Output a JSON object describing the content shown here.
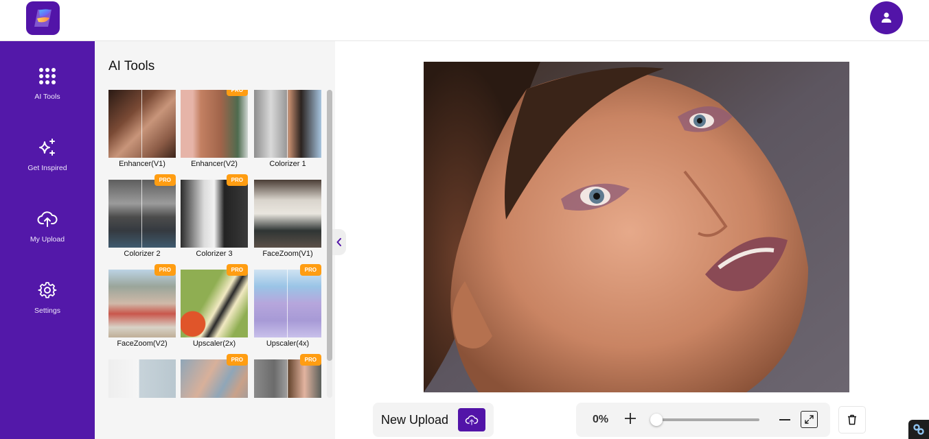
{
  "app": {
    "logo_icon": "app-logo",
    "brand_color": "#5214a8",
    "pro_badge_color": "#ff9d12"
  },
  "header": {
    "account_icon": "user-icon"
  },
  "sidebar": {
    "items": [
      {
        "label": "AI Tools",
        "icon": "grid-icon"
      },
      {
        "label": "Get Inspired",
        "icon": "sparkles-icon"
      },
      {
        "label": "My Upload",
        "icon": "cloud-upload-icon"
      },
      {
        "label": "Settings",
        "icon": "gear-icon"
      }
    ]
  },
  "tools_panel": {
    "title": "AI Tools",
    "pro_label": "PRO",
    "tools": [
      {
        "name": "Enhancer(V1)",
        "pro": false
      },
      {
        "name": "Enhancer(V2)",
        "pro": true
      },
      {
        "name": "Colorizer 1",
        "pro": false
      },
      {
        "name": "Colorizer 2",
        "pro": true
      },
      {
        "name": "Colorizer 3",
        "pro": true
      },
      {
        "name": "FaceZoom(V1)",
        "pro": false
      },
      {
        "name": "FaceZoom(V2)",
        "pro": true
      },
      {
        "name": "Upscaler(2x)",
        "pro": true
      },
      {
        "name": "Upscaler(4x)",
        "pro": true
      },
      {
        "name": "",
        "pro": false
      },
      {
        "name": "",
        "pro": true
      },
      {
        "name": "",
        "pro": true
      }
    ]
  },
  "canvas": {
    "image_description": "portrait-photo"
  },
  "bottom_bar": {
    "new_upload_label": "New Upload",
    "zoom_percent": "0%",
    "zoom_value": 0
  }
}
